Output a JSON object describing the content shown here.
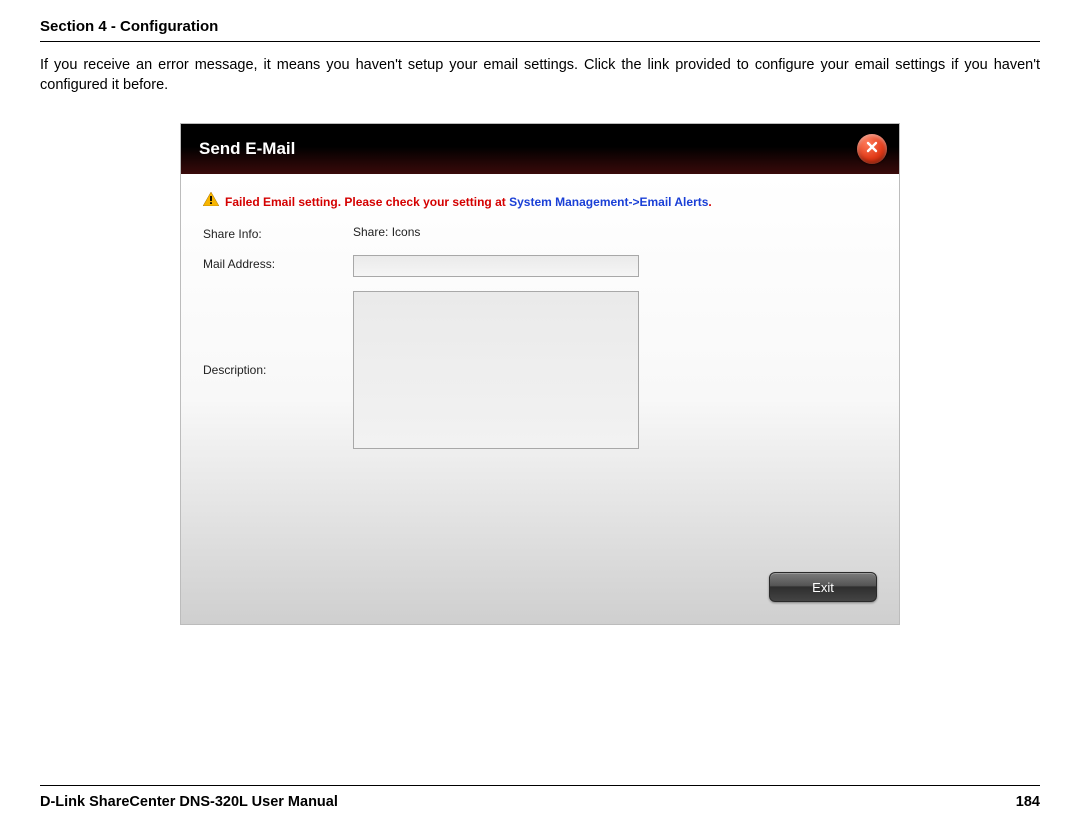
{
  "header": {
    "section": "Section 4 - Configuration"
  },
  "intro": "If you receive an error message, it means you haven't setup your email settings. Click the link provided to configure your email settings if you haven't configured it before.",
  "dialog": {
    "title": "Send E-Mail",
    "alert": {
      "prefix": "Failed Email setting. Please check your setting at ",
      "link": "System Management->Email Alerts",
      "suffix": "."
    },
    "fields": {
      "share_info_label": "Share Info:",
      "share_info_value": "Share: Icons",
      "mail_address_label": "Mail Address:",
      "mail_address_value": "",
      "description_label": "Description:",
      "description_value": ""
    },
    "buttons": {
      "exit": "Exit"
    }
  },
  "footer": {
    "manual": "D-Link ShareCenter DNS-320L User Manual",
    "page": "184"
  }
}
